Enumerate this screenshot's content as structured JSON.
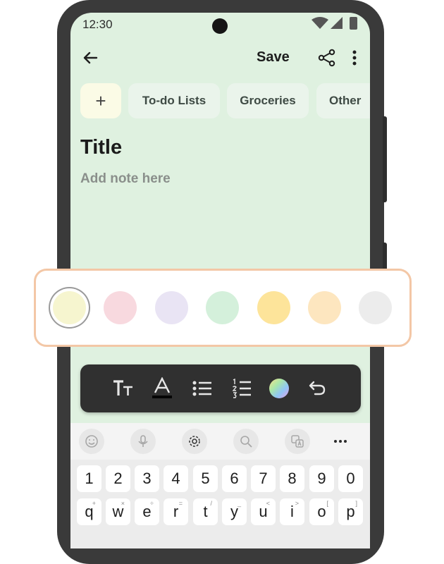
{
  "status_bar": {
    "time": "12:30"
  },
  "app_bar": {
    "save_label": "Save"
  },
  "chips": {
    "add_label": "+",
    "items": [
      "To-do Lists",
      "Groceries",
      "Other"
    ]
  },
  "note": {
    "title": "Title",
    "body_placeholder": "Add note here"
  },
  "colors": {
    "swatches": [
      "#f6f5cf",
      "#f8d9df",
      "#e9e4f4",
      "#d4f0db",
      "#fde49a",
      "#fde6bf",
      "#ececec"
    ],
    "selected": 0,
    "card_border": "#f3c7a6",
    "note_background": "#dff1e0"
  },
  "keyboard": {
    "numbers": [
      "1",
      "2",
      "3",
      "4",
      "5",
      "6",
      "7",
      "8",
      "9",
      "0"
    ],
    "letters": [
      "q",
      "w",
      "e",
      "r",
      "t",
      "y",
      "u",
      "i",
      "o",
      "p"
    ],
    "hints": [
      "+",
      "×",
      "÷",
      "=",
      "/",
      "_",
      "<",
      ">",
      "[",
      "]"
    ],
    "suggestion_icons": [
      "emoji-icon",
      "microphone-icon",
      "settings-icon",
      "search-icon",
      "translate-icon",
      "more-horizontal-icon"
    ],
    "more_label": "..."
  }
}
